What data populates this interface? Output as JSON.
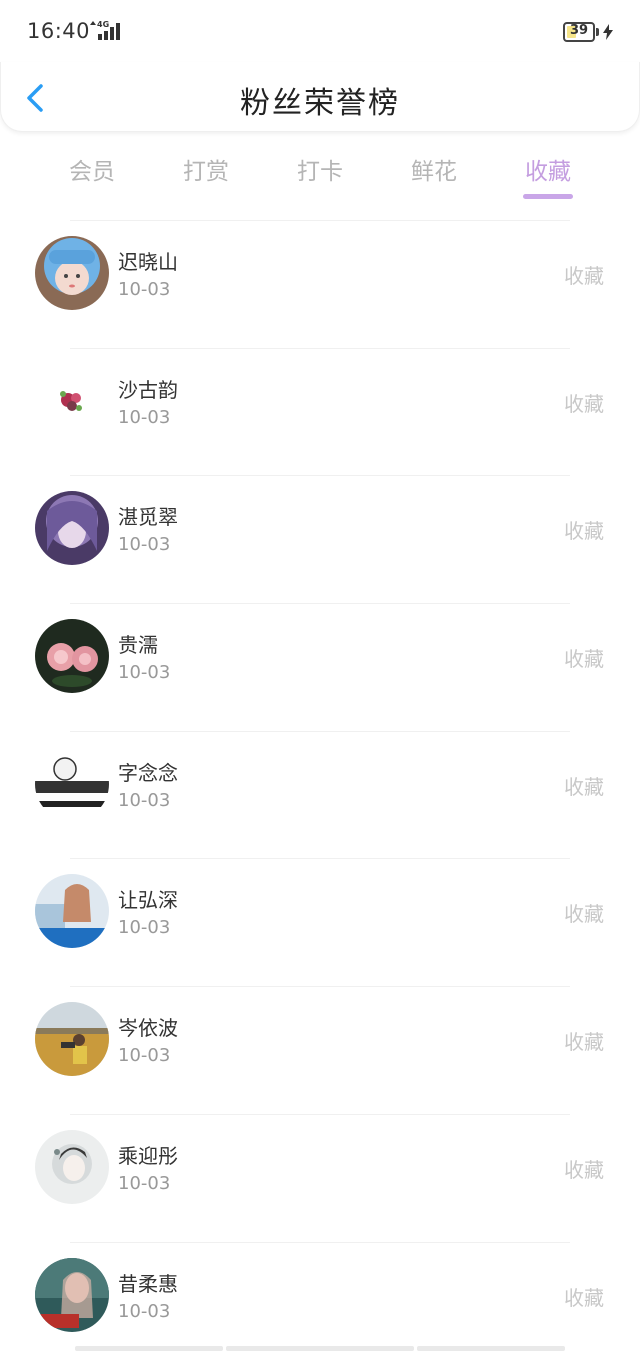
{
  "status": {
    "time": "16:40",
    "network": "4G",
    "battery": "39",
    "battery_level": 0.39
  },
  "header": {
    "title": "粉丝荣誉榜"
  },
  "tabs": [
    {
      "label": "会员",
      "active": false
    },
    {
      "label": "打赏",
      "active": false
    },
    {
      "label": "打卡",
      "active": false
    },
    {
      "label": "鲜花",
      "active": false
    },
    {
      "label": "收藏",
      "active": true
    }
  ],
  "accent_color": "#c49ee0",
  "fans": [
    {
      "name": "迟晓山",
      "date": "10-03",
      "action": "收藏"
    },
    {
      "name": "沙古韵",
      "date": "10-03",
      "action": "收藏"
    },
    {
      "name": "湛觅翠",
      "date": "10-03",
      "action": "收藏"
    },
    {
      "name": "贵濡",
      "date": "10-03",
      "action": "收藏"
    },
    {
      "name": "字念念",
      "date": "10-03",
      "action": "收藏"
    },
    {
      "name": "让弘深",
      "date": "10-03",
      "action": "收藏"
    },
    {
      "name": "岑依波",
      "date": "10-03",
      "action": "收藏"
    },
    {
      "name": "乘迎彤",
      "date": "10-03",
      "action": "收藏"
    },
    {
      "name": "昔柔惠",
      "date": "10-03",
      "action": "收藏"
    }
  ]
}
